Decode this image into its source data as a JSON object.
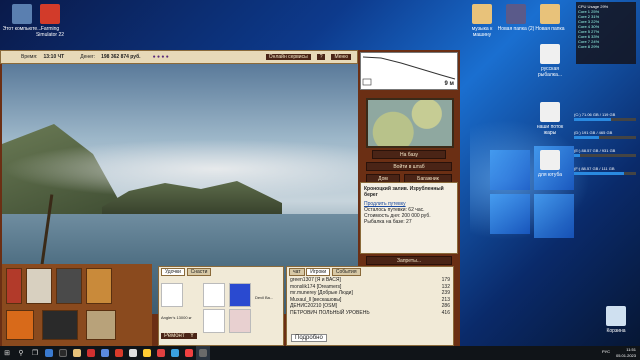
{
  "desktop": {
    "icons_left": [
      {
        "label": "Этот компьюте...",
        "color": "#5a7fb0"
      },
      {
        "label": "Farming Simulator 22",
        "color": "#d23b2a"
      }
    ],
    "icons_right": [
      {
        "label": "музыка к машину",
        "color": "#e8c27a"
      },
      {
        "label": "Новая папка (2)",
        "color": "#5a5a8a"
      },
      {
        "label": "Новая папка",
        "color": "#e8c27a"
      }
    ],
    "icon_mid": [
      {
        "label": "русская рыбалка..."
      },
      {
        "label": "наши поток жары"
      },
      {
        "label": "для ютуба"
      }
    ],
    "recycle_label": "Корзина"
  },
  "game": {
    "topbar": {
      "time_label": "Время:",
      "time_value": "13:10 ЧТ",
      "money_label": "Денег:",
      "money_value": "198 362 874 руб.",
      "online_btn": "Онлайн сервисы",
      "help_btn": "?",
      "menu_btn": "Меню"
    },
    "depth_value": "9 м",
    "map_buttons": {
      "base": "На базу",
      "hq": "Войти в штаб",
      "home": "Дом",
      "baggage": "Багажник"
    },
    "location": {
      "title": "Кроноцкий залив. Изрубленный берег",
      "continue": "Продлить путевку",
      "left": "Осталось путевки: 62 час.",
      "cost": "Стоимость дня: 200 000 руб.",
      "base": "Рыбалка на базе: 27"
    },
    "bans_btn": "Запреты...",
    "gear": {
      "rod_name": "Angler's 13000 кг",
      "reel": "Devil Ba...",
      "repair": "Ремонт",
      "cut": "Y",
      "tab1": "Удочки",
      "tab2": "Снасти"
    },
    "chat": {
      "tab_chat": "чат",
      "tab_players": "Игроки",
      "tab_events": "События",
      "rows": [
        {
          "name": "green1307 [Я и ВАСЯ]",
          "val": "179"
        },
        {
          "name": "monslik174 [Dreamers]",
          "val": "132"
        },
        {
          "name": "mr.munerey [Добрые Люди]",
          "val": "239"
        },
        {
          "name": "Muxaul_ll [вeскашовы]",
          "val": "213"
        },
        {
          "name": "ДЕНИС20210 [OSM]",
          "val": "286"
        },
        {
          "name": "ПЕТРОВИЧ ПОЛЬНЫЙ УРОВЕНЬ",
          "val": "416"
        }
      ],
      "more": "Подробно"
    }
  },
  "widget": {
    "title": "CPU Usage  29%",
    "lines": [
      "Core 1  25%",
      "Core 2  31%",
      "Core 3  22%",
      "Core 4  30%",
      "Core 5  27%",
      "Core 6  33%",
      "Core 7  24%",
      "Core 8  29%"
    ]
  },
  "drives": [
    {
      "label": "(C:) 71.06 GB / 119 GB",
      "fill": 0.6
    },
    {
      "label": "(D:) 191 GB / 465 GB",
      "fill": 0.41
    },
    {
      "label": "(E:) 88.57 GB / 931 GB",
      "fill": 0.1
    },
    {
      "label": "(F:) 88.57 GB / 111 GB",
      "fill": 0.8
    }
  ],
  "taskbar": {
    "time": "11:51",
    "date": "05.01.2023",
    "lang": "РУС"
  }
}
